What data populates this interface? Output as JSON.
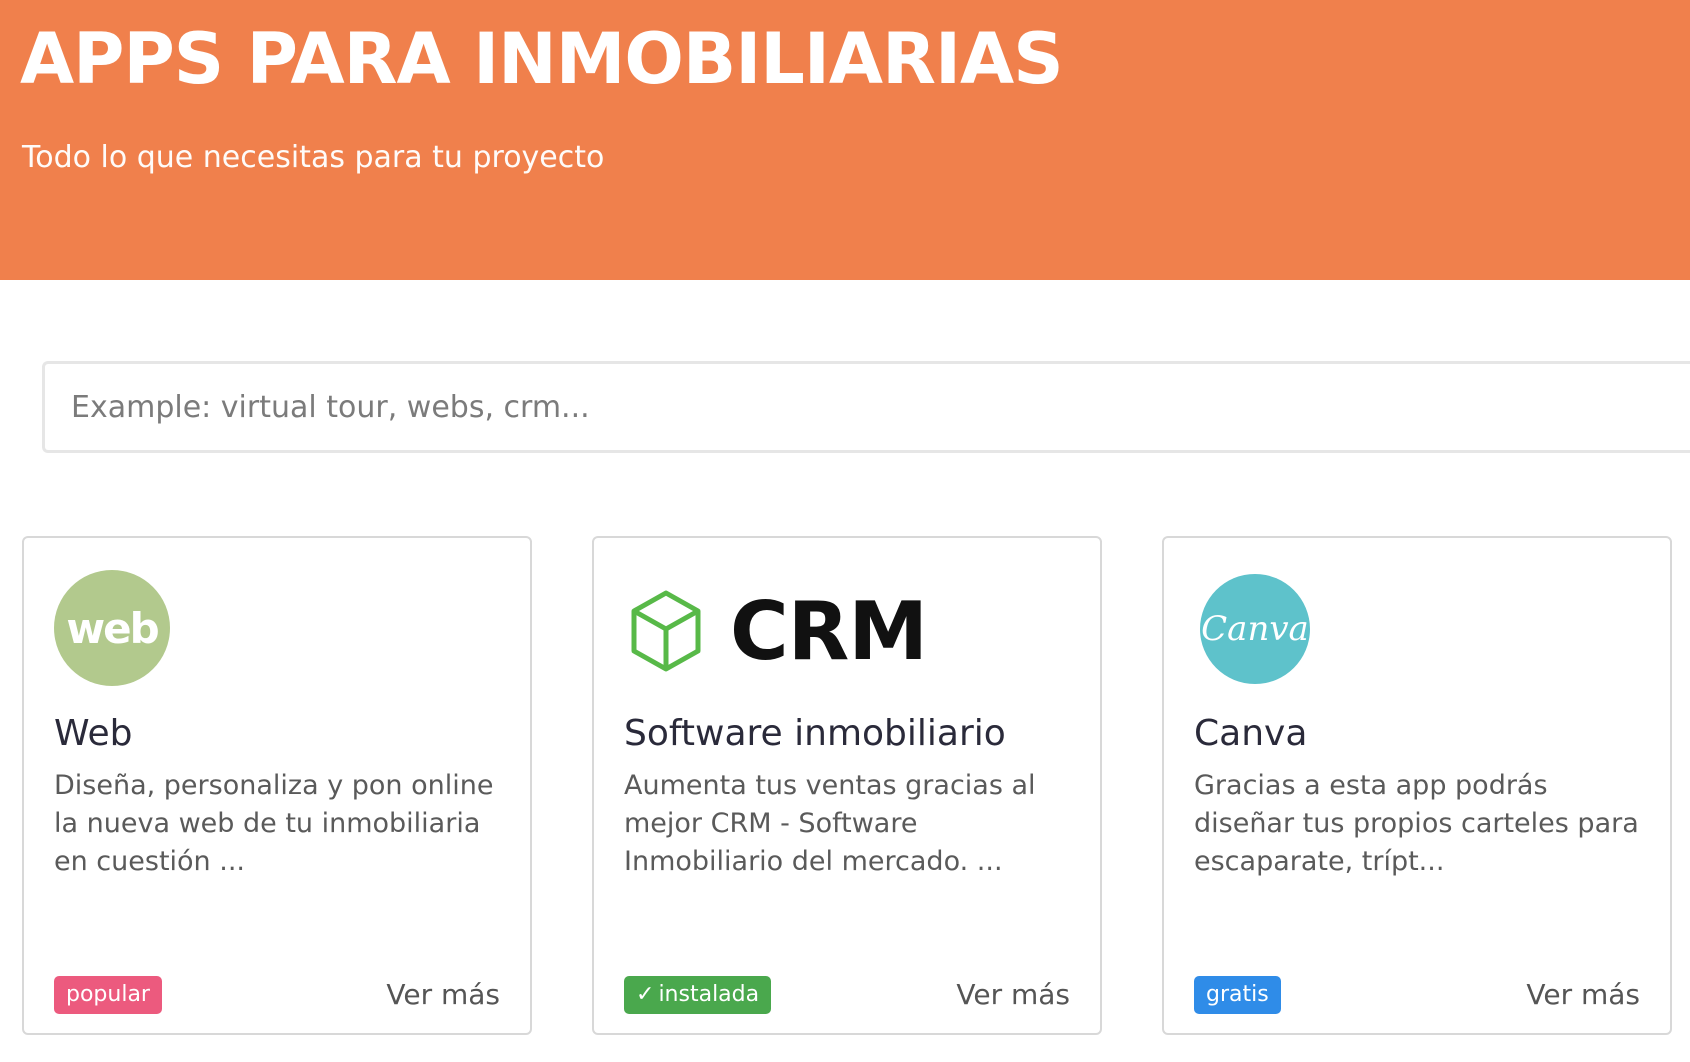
{
  "header": {
    "title": "APPS PARA INMOBILIARIAS",
    "subtitle": "Todo lo que necesitas para tu proyecto"
  },
  "search": {
    "placeholder": "Example: virtual tour, webs, crm..."
  },
  "colors": {
    "header_bg": "#f0804c",
    "badge_popular": "#ec5a7e",
    "badge_installed": "#4aa84d",
    "badge_free": "#2f8ce8"
  },
  "cards": [
    {
      "logo_text": "web",
      "title": "Web",
      "description": "Diseña, personaliza y pon online la nueva web de tu inmobiliaria en cuestión ...",
      "badge": "popular",
      "link": "Ver más"
    },
    {
      "logo_text": "CRM",
      "logo_icon": "cube-icon",
      "title": "Software inmobiliario",
      "description": "Aumenta tus ventas gracias al mejor CRM - Software Inmobiliario del mercado. ...",
      "badge": "instalada",
      "badge_icon": "check-icon",
      "link": "Ver más"
    },
    {
      "logo_text": "Canva",
      "title": "Canva",
      "description": "Gracias a esta app podrás diseñar tus propios carteles para escaparate, trípt...",
      "badge": "gratis",
      "link": "Ver más"
    }
  ]
}
